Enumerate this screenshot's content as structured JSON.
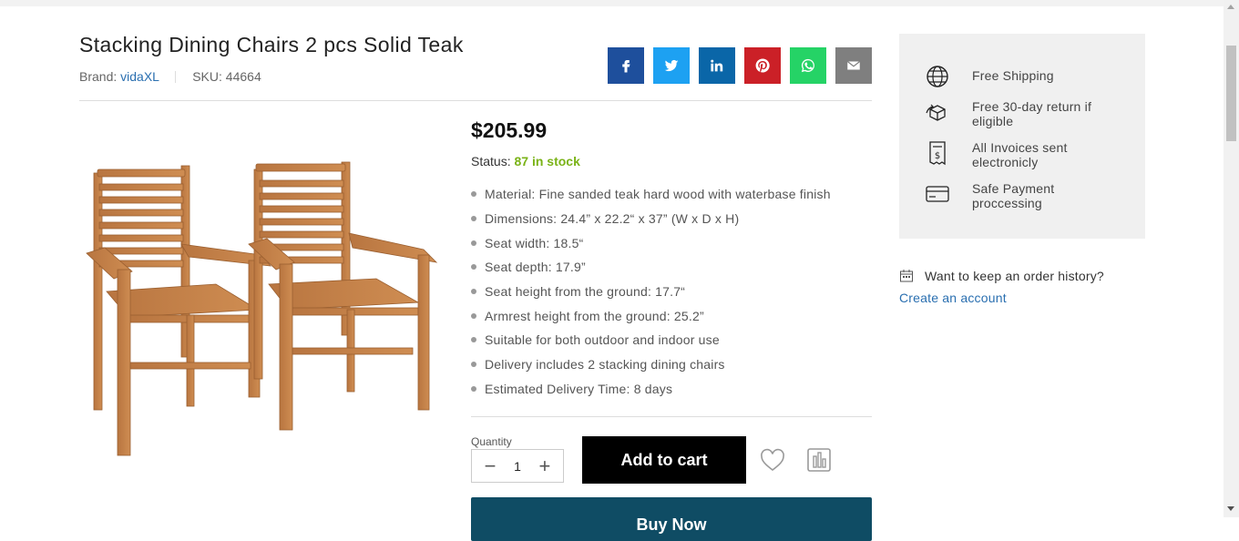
{
  "product": {
    "title": "Stacking Dining Chairs 2 pcs Solid Teak",
    "brand_label": "Brand:",
    "brand": "vidaXL",
    "sku_label": "SKU:",
    "sku": "44664",
    "price": "$205.99",
    "status_label": "Status:",
    "status_value": "87 in stock",
    "features": [
      "Material: Fine sanded teak hard wood with waterbase finish",
      "Dimensions: 24.4” x 22.2“ x 37” (W x D x H)",
      "Seat width: 18.5“",
      "Seat depth: 17.9”",
      "Seat height from the ground: 17.7“",
      "Armrest height from the ground: 25.2”",
      "Suitable for both outdoor and indoor use",
      "Delivery includes 2 stacking dining chairs",
      "Estimated Delivery Time: 8 days"
    ]
  },
  "share": [
    {
      "icon": "facebook-icon",
      "color": "#1e4f9c"
    },
    {
      "icon": "twitter-icon",
      "color": "#1da1f2"
    },
    {
      "icon": "linkedin-icon",
      "color": "#0a66a8"
    },
    {
      "icon": "pinterest-icon",
      "color": "#cb2027"
    },
    {
      "icon": "whatsapp-icon",
      "color": "#25d366"
    },
    {
      "icon": "email-icon",
      "color": "#7f7f7f"
    }
  ],
  "cart": {
    "quantity_label": "Quantity",
    "quantity_value": "1",
    "decrement": "−",
    "increment": "+",
    "add_to_cart": "Add to cart",
    "buy_now": "Buy Now"
  },
  "sidebar": {
    "items": [
      {
        "icon": "globe-icon",
        "text": "Free Shipping"
      },
      {
        "icon": "box-return-icon",
        "text": "Free 30-day return if eligible"
      },
      {
        "icon": "invoice-icon",
        "text": "All Invoices sent electronicly"
      },
      {
        "icon": "credit-card-icon",
        "text": "Safe Payment proccessing"
      }
    ],
    "history_text": "Want to keep an order history?",
    "create_account": "Create an account"
  },
  "colors": {
    "stock_green": "#7ab317",
    "link_blue": "#2a6fb0",
    "buy_now_bg": "#0f4c64"
  }
}
